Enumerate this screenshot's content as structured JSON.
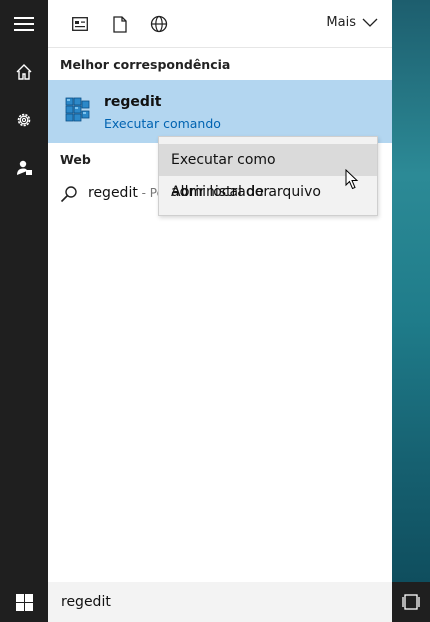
{
  "header": {
    "more_label": "Mais"
  },
  "sidebar": {
    "items": [
      {
        "icon": "menu-icon"
      },
      {
        "icon": "home-icon"
      },
      {
        "icon": "gear-icon"
      },
      {
        "icon": "person-icon"
      }
    ]
  },
  "topbar": {
    "filters": [
      {
        "icon": "apps-filter-icon"
      },
      {
        "icon": "documents-filter-icon"
      },
      {
        "icon": "web-filter-icon"
      }
    ]
  },
  "best_match": {
    "heading": "Melhor correspondência",
    "title": "regedit",
    "subtitle": "Executar comando"
  },
  "web": {
    "heading": "Web",
    "query": "regedit",
    "hint": " - Pe"
  },
  "context_menu": {
    "items": [
      {
        "label": "Executar como administrador"
      },
      {
        "label": "Abrir local de arquivo"
      }
    ]
  },
  "search": {
    "value": "regedit"
  },
  "colors": {
    "accent": "#0063b1",
    "selection": "#b3d6f0",
    "rail": "#1f1f1f"
  }
}
